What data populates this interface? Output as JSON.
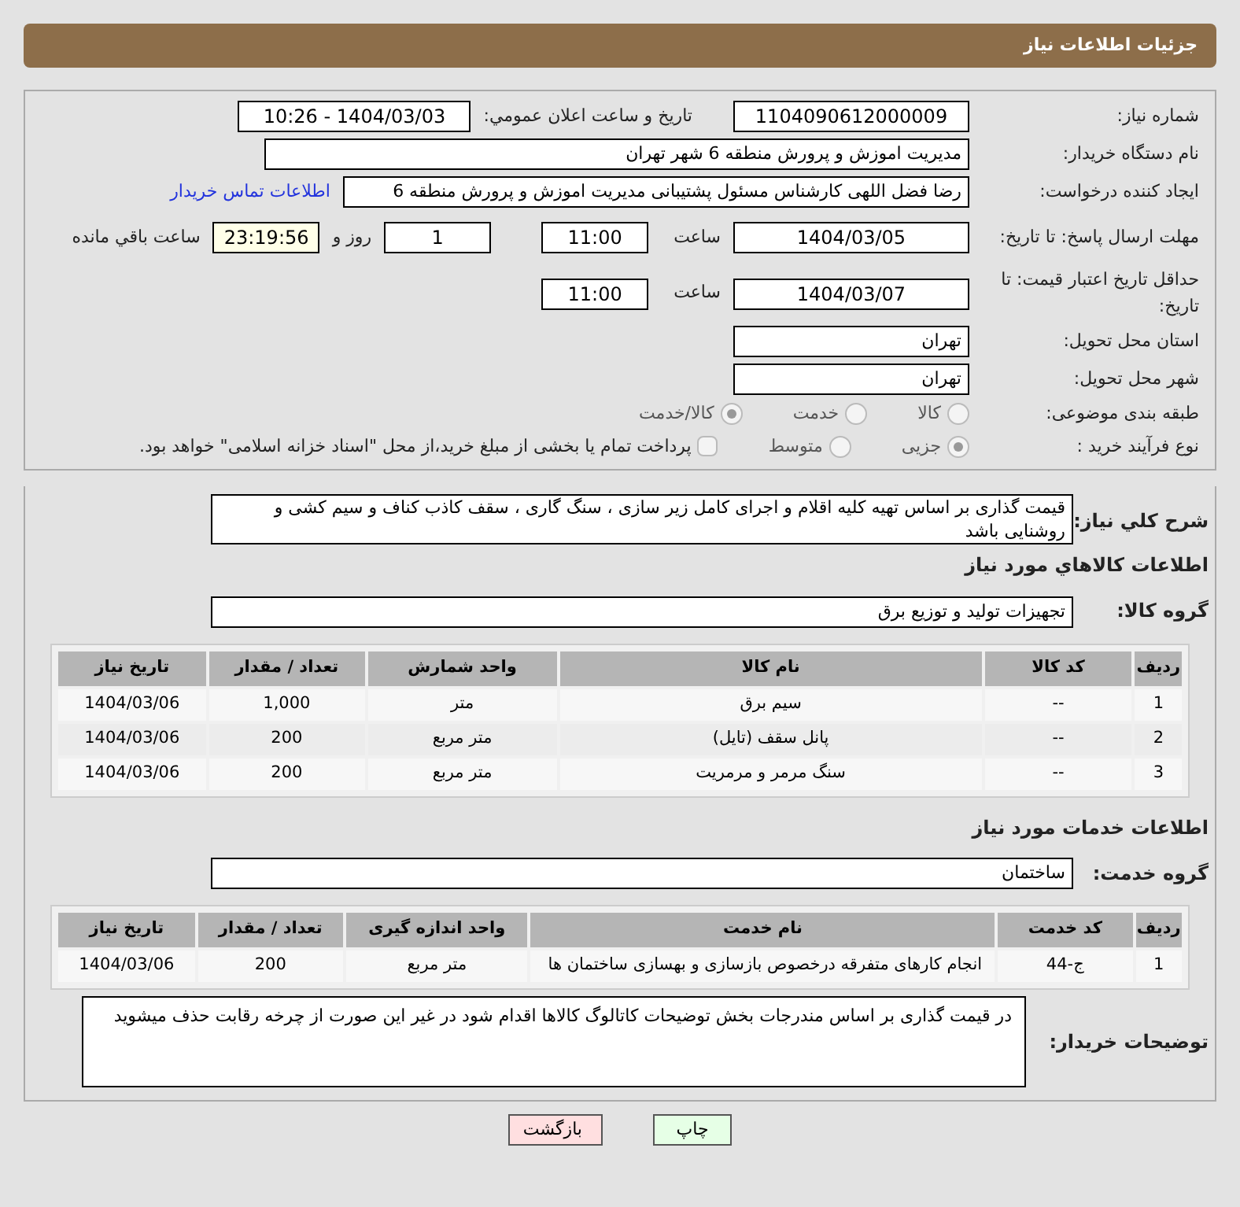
{
  "header": {
    "title": "جزئیات اطلاعات نیاز"
  },
  "need_number": {
    "label": "شماره نیاز:",
    "value": "1104090612000009"
  },
  "announce": {
    "label": "تاریخ و ساعت اعلان عمومي:",
    "value": "1404/03/03 - 10:26"
  },
  "buyer_org": {
    "label": "نام دستگاه خریدار:",
    "value": "مدیریت اموزش و پرورش منطقه 6 شهر تهران"
  },
  "creator": {
    "label": "ایجاد کننده درخواست:",
    "value": "رضا فضل اللهی کارشناس مسئول پشتیبانی  مدیریت اموزش و پرورش منطقه 6",
    "link": "اطلاعات تماس خریدار"
  },
  "reply_deadline": {
    "label": "مهلت ارسال پاسخ: تا تاریخ:",
    "date": "1404/03/05",
    "time_label": "ساعت",
    "time": "11:00",
    "days": "1",
    "days_label": "روز و",
    "remaining": "23:19:56",
    "remaining_label": "ساعت باقي مانده"
  },
  "price_validity": {
    "label": "حداقل تاریخ اعتبار قیمت: تا تاریخ:",
    "date": "1404/03/07",
    "time_label": "ساعت",
    "time": "11:00"
  },
  "province": {
    "label": "استان محل تحویل:",
    "value": "تهران"
  },
  "city": {
    "label": "شهر محل تحویل:",
    "value": "تهران"
  },
  "category": {
    "label": "طبقه بندی موضوعی:",
    "options": [
      {
        "label": "کالا",
        "selected": false
      },
      {
        "label": "خدمت",
        "selected": false
      },
      {
        "label": "کالا/خدمت",
        "selected": true
      }
    ]
  },
  "purchase_type": {
    "label": "نوع فرآیند خرید :",
    "options": [
      {
        "label": "جزیی",
        "selected": true
      },
      {
        "label": "متوسط",
        "selected": false
      }
    ],
    "payment": {
      "checked": false,
      "text": "پرداخت تمام یا بخشی از مبلغ خرید،از محل \"اسناد خزانه اسلامی\" خواهد بود."
    }
  },
  "description": {
    "label": "شرح كلي نياز:",
    "value": "قیمت گذاری بر اساس تهیه کلیه اقلام و اجرای کامل زیر سازی ، سنگ گاری ، سقف کاذب کناف و سیم کشی و روشنایی باشد"
  },
  "goods": {
    "heading": "اطلاعات کالاهاي مورد نياز",
    "group_label": "گروه کالا:",
    "group": "تجهیزات تولید و توزیع برق",
    "table": {
      "columns": [
        "ردیف",
        "کد کالا",
        "نام کالا",
        "واحد شمارش",
        "تعداد / مقدار",
        "تاریخ نیاز"
      ],
      "rows": [
        [
          "1",
          "--",
          "سیم برق",
          "متر",
          "1,000",
          "1404/03/06"
        ],
        [
          "2",
          "--",
          "پانل سقف (تایل)",
          "متر مربع",
          "200",
          "1404/03/06"
        ],
        [
          "3",
          "--",
          "سنگ مرمر و مرمریت",
          "متر مربع",
          "200",
          "1404/03/06"
        ]
      ]
    }
  },
  "services": {
    "heading": "اطلاعات خدمات مورد نیاز",
    "group_label": "گروه خدمت:",
    "group": "ساختمان",
    "table": {
      "columns": [
        "ردیف",
        "کد خدمت",
        "نام خدمت",
        "واحد اندازه گیری",
        "تعداد / مقدار",
        "تاریخ نیاز"
      ],
      "rows": [
        [
          "1",
          "ج-44",
          "انجام کارهای متفرقه درخصوص بازسازی و بهسازی ساختمان ها",
          "متر مربع",
          "200",
          "1404/03/06"
        ]
      ]
    }
  },
  "buyer_notes": {
    "label": "توضیحات خریدار:",
    "value": "در قیمت گذاری بر اساس مندرجات بخش توضیحات کاتالوگ کالاها اقدام شود در غیر این صورت از چرخه رقابت حذف میشوید"
  },
  "buttons": [
    {
      "label": "چاپ",
      "kind": "print"
    },
    {
      "label": "بازگشت",
      "kind": "back"
    }
  ]
}
